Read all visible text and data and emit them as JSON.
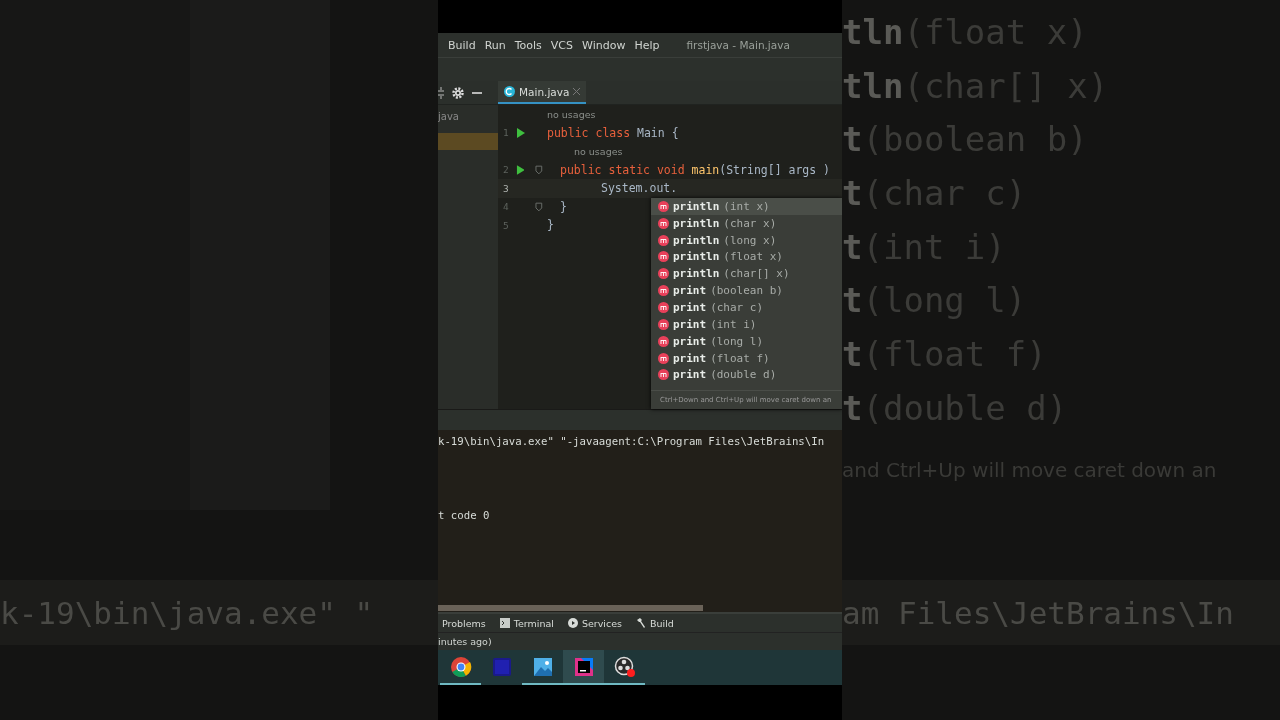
{
  "backdrop": {
    "right_lines": [
      {
        "bold": "tln",
        "rest": "(float x)"
      },
      {
        "bold": "tln",
        "rest": "(char[] x)"
      },
      {
        "bold": "t",
        "rest": "(boolean b)"
      },
      {
        "bold": "t",
        "rest": "(char c)"
      },
      {
        "bold": "t",
        "rest": "(int i)"
      },
      {
        "bold": "t",
        "rest": "(long l)"
      },
      {
        "bold": "t",
        "rest": "(float f)"
      },
      {
        "bold": "t",
        "rest": "(double d)"
      }
    ],
    "right_hint": "and Ctrl+Up will move caret down an",
    "band_left": "k-19\\bin\\java.exe\" \"",
    "band_right": "am Files\\JetBrains\\In"
  },
  "menu_bar": {
    "items": [
      "Build",
      "Run",
      "Tools",
      "VCS",
      "Window",
      "Help"
    ],
    "title": "firstjava - Main.java"
  },
  "tabs": [
    {
      "label": "Main.java",
      "selected": true
    }
  ],
  "sidebar": {
    "items": [
      {
        "label": "java",
        "selected": false
      },
      {
        "selected": true
      }
    ]
  },
  "editor": {
    "lines": [
      {
        "kind": "hint",
        "text": "no usages"
      },
      {
        "kind": "code",
        "number": "1",
        "run": true,
        "fold": false,
        "current": false,
        "tokens": [
          {
            "text": "public class ",
            "kind": "keyword"
          },
          {
            "text": "Main {",
            "kind": "plain"
          }
        ],
        "children": [
          {
            "kind": "hint",
            "text": "no usages"
          },
          {
            "kind": "code",
            "number": "2",
            "run": true,
            "fold": true,
            "current": false,
            "tokens": [
              {
                "text": "public static void ",
                "kind": "keyword"
              },
              {
                "text": "main",
                "kind": "method"
              },
              {
                "text": "(String[] args )",
                "kind": "plain"
              }
            ],
            "children": [
              {
                "kind": "code",
                "number": "3",
                "run": false,
                "fold": false,
                "current": true,
                "tokens": [
                  {
                    "text": "System.out.",
                    "kind": "plain"
                  }
                ]
              }
            ]
          },
          {
            "kind": "code",
            "number": "4",
            "run": false,
            "fold": true,
            "current": false,
            "tokens": [
              {
                "text": "}",
                "kind": "plain"
              }
            ]
          }
        ]
      },
      {
        "kind": "code",
        "number": "5",
        "run": false,
        "fold": false,
        "current": false,
        "tokens": [
          {
            "text": "}",
            "kind": "plain"
          }
        ]
      }
    ]
  },
  "completion": {
    "items": [
      {
        "name": "println",
        "params": "(int x)",
        "selected": true
      },
      {
        "name": "println",
        "params": "(char x)",
        "selected": false
      },
      {
        "name": "println",
        "params": "(long x)",
        "selected": false
      },
      {
        "name": "println",
        "params": "(float x)",
        "selected": false
      },
      {
        "name": "println",
        "params": "(char[] x)",
        "selected": false
      },
      {
        "name": "print",
        "params": "(boolean b)",
        "selected": false
      },
      {
        "name": "print",
        "params": "(char c)",
        "selected": false
      },
      {
        "name": "print",
        "params": "(int i)",
        "selected": false
      },
      {
        "name": "print",
        "params": "(long l)",
        "selected": false
      },
      {
        "name": "print",
        "params": "(float f)",
        "selected": false
      },
      {
        "name": "print",
        "params": "(double d)",
        "selected": false
      }
    ],
    "hint": "Ctrl+Down and Ctrl+Up will move caret down an"
  },
  "console": {
    "lines": [
      "k-19\\bin\\java.exe\" \"-javaagent:C:\\Program Files\\JetBrains\\In",
      "t code 0"
    ]
  },
  "tool_tabs": [
    {
      "label": "Problems",
      "kind": "problems"
    },
    {
      "label": "Terminal",
      "kind": "terminal"
    },
    {
      "label": "Services",
      "kind": "services"
    },
    {
      "label": "Build",
      "kind": "build"
    }
  ],
  "status_bar": {
    "text": "inutes ago)"
  },
  "taskbar": [
    {
      "kind": "chrome",
      "running": true,
      "selected": false
    },
    {
      "kind": "premiere",
      "running": false,
      "selected": false
    },
    {
      "kind": "photos",
      "running": true,
      "selected": false
    },
    {
      "kind": "intellij",
      "running": true,
      "selected": true
    },
    {
      "kind": "obs",
      "running": true,
      "selected": false
    }
  ]
}
